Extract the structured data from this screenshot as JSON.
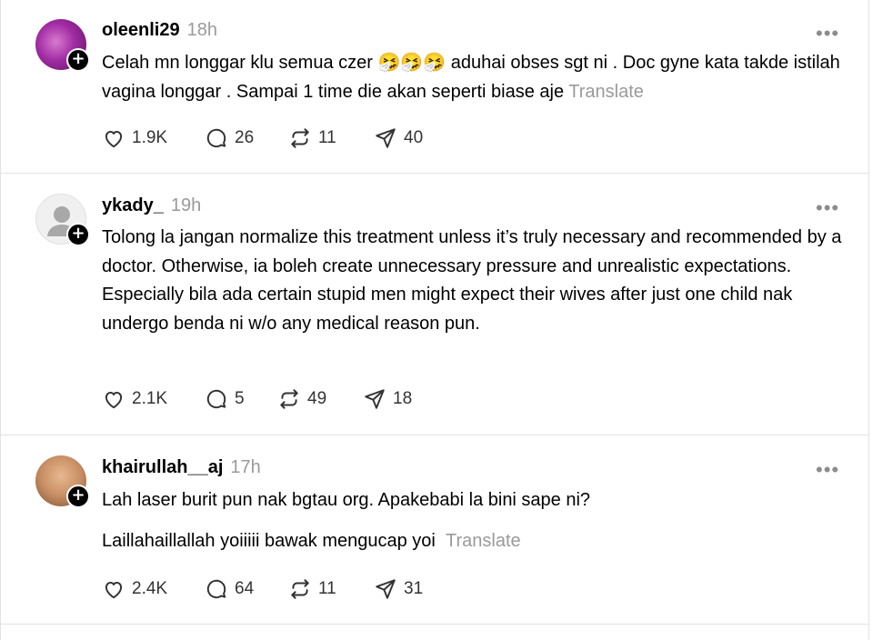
{
  "posts": [
    {
      "username": "oleenli29",
      "time": "18h",
      "text_before_emoji": "Celah mn longgar klu semua czer ",
      "emoji": "🤧🤧🤧",
      "text_after_emoji": " aduhai obses sgt ni . Doc gyne kata takde istilah vagina longgar . Sampai 1 time die akan seperti biase aje",
      "translate": "Translate",
      "likes": "1.9K",
      "replies": "26",
      "reposts": "11",
      "shares": "40"
    },
    {
      "username": "ykady_",
      "time": "19h",
      "text": "Tolong la jangan normalize this treatment unless it’s truly necessary and recommended by a doctor. Otherwise, ia boleh create unnecessary pressure and unrealistic expectations. Especially bila ada certain stupid men might expect their wives after just one child nak undergo benda ni w/o any medical reason pun.",
      "likes": "2.1K",
      "replies": "5",
      "reposts": "49",
      "shares": "18"
    },
    {
      "username": "khairullah__aj",
      "time": "17h",
      "text_line1": "Lah laser burit pun nak bgtau org. Apakebabi la bini sape ni?",
      "text_line2": "Laillahaillallah yoiiiii bawak mengucap yoi",
      "translate": "Translate",
      "likes": "2.4K",
      "replies": "64",
      "reposts": "11",
      "shares": "31"
    }
  ],
  "icons": {
    "like": "heart-icon",
    "reply": "comment-icon",
    "repost": "repost-icon",
    "share": "send-icon",
    "more": "more-icon",
    "follow": "plus-icon"
  },
  "colors": {
    "text": "#000000",
    "muted": "#9a9a9a",
    "divider": "#e2e2e2",
    "badge": "#000000"
  }
}
